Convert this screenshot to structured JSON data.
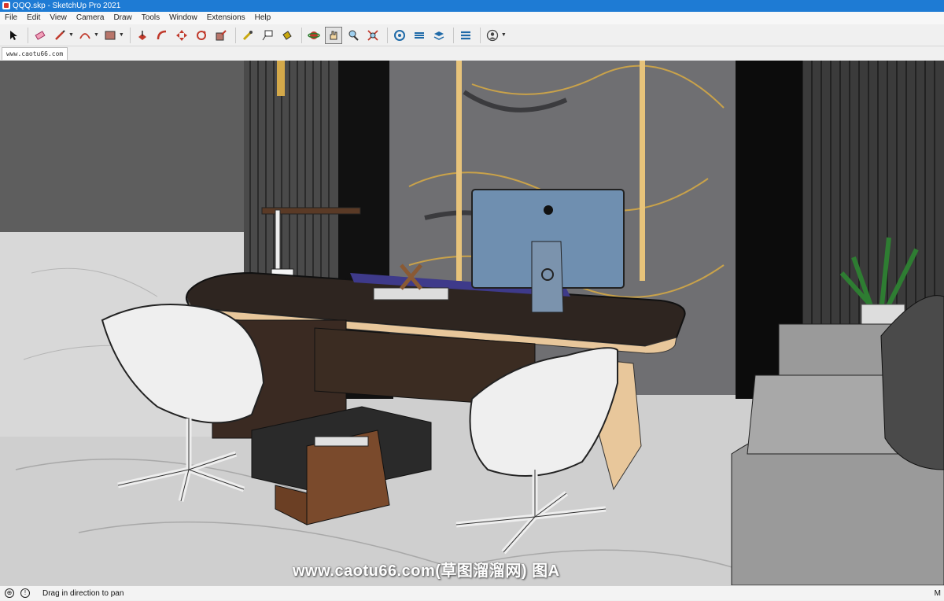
{
  "window": {
    "title": "QQQ.skp - SketchUp Pro 2021"
  },
  "menu": [
    "File",
    "Edit",
    "View",
    "Camera",
    "Draw",
    "Tools",
    "Window",
    "Extensions",
    "Help"
  ],
  "toolbar": {
    "tools": [
      "select-arrow-icon",
      "eraser-icon",
      "pencil-line-icon",
      "arc-icon",
      "rectangle-icon",
      "push-pull-icon",
      "follow-me-icon",
      "move-icon",
      "rotate-icon",
      "scale-icon",
      "tape-measure-icon",
      "text-label-icon",
      "paint-bucket-icon",
      "orbit-icon",
      "pan-icon",
      "zoom-icon",
      "zoom-extents-icon",
      "warehouse-icon",
      "extension-icon",
      "layers-icon",
      "styles-icon",
      "account-icon"
    ],
    "active_tool": "pan-icon"
  },
  "scene_tab": {
    "label": "www.caotu66.com"
  },
  "viewport": {
    "watermark": "www.caotu66.com(草图溜溜网) 图A"
  },
  "status": {
    "message": "Drag in direction to pan",
    "right_label": "M"
  }
}
